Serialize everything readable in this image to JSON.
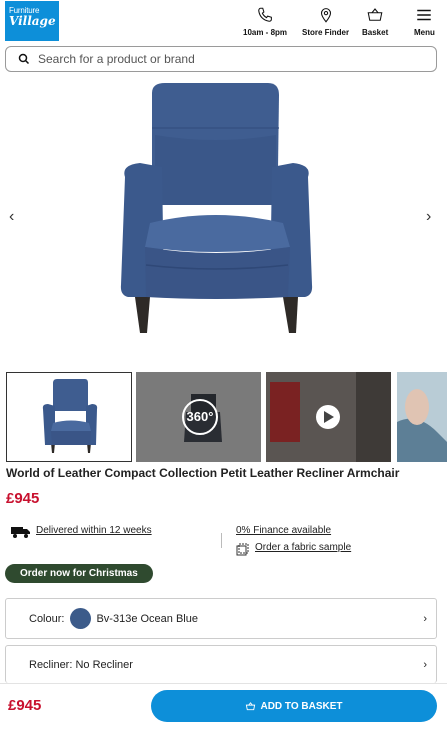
{
  "header": {
    "logo_line1": "Furniture",
    "logo_line2": "Village",
    "nav": [
      {
        "label": "10am - 8pm",
        "icon": "phone-icon"
      },
      {
        "label": "Store Finder",
        "icon": "location-pin-icon"
      },
      {
        "label": "Basket",
        "icon": "basket-icon"
      },
      {
        "label": "Menu",
        "icon": "hamburger-menu-icon"
      }
    ]
  },
  "search": {
    "placeholder": "Search for a product or brand"
  },
  "gallery": {
    "thumb_360_label": "360°",
    "arrows": {
      "prev": "‹",
      "next": "›"
    }
  },
  "product": {
    "title": "World of Leather Compact Collection Petit Leather Recliner Armchair",
    "price": "£945",
    "delivery": "Delivered within 12 weeks",
    "finance": "0% Finance available",
    "sample": "Order a fabric sample",
    "badge": "Order now for Christmas"
  },
  "options": {
    "colour_label": "Colour:",
    "colour_value": "Bv-313e Ocean Blue",
    "recliner_label": "Recliner: No Recliner",
    "chevron": "›"
  },
  "bottom_bar": {
    "price": "£945",
    "add_label": "ADD TO BASKET"
  },
  "colors": {
    "brand_blue": "#0d8fd9",
    "price_red": "#c8102e",
    "badge_green": "#2f4a2f",
    "chair_blue": "#3c5b8a"
  }
}
